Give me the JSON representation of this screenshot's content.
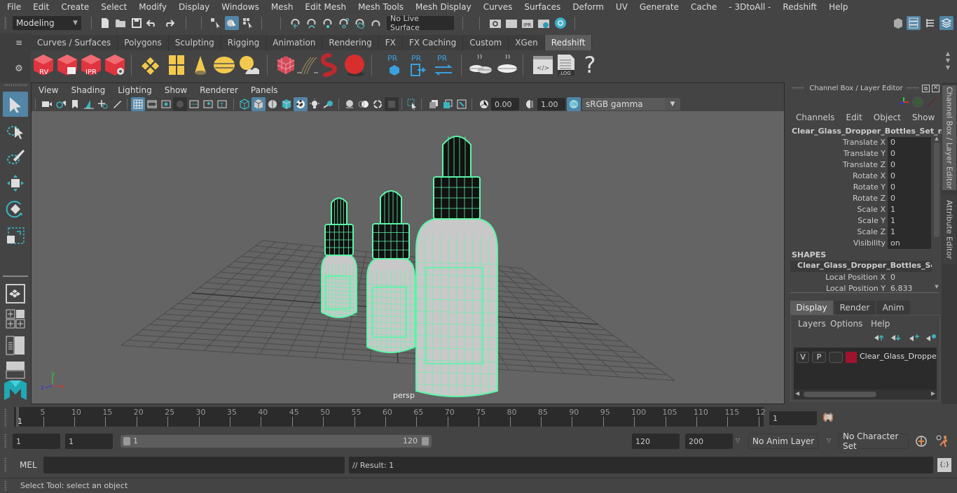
{
  "menubar": {
    "items": [
      "File",
      "Edit",
      "Create",
      "Select",
      "Modify",
      "Display",
      "Windows",
      "Mesh",
      "Edit Mesh",
      "Mesh Tools",
      "Mesh Display",
      "Curves",
      "Surfaces",
      "Deform",
      "UV",
      "Generate",
      "Cache",
      "- 3DtoAll -",
      "Redshift",
      "Help"
    ]
  },
  "statusline": {
    "workspace_mode": "Modeling",
    "live_surface": "No Live Surface",
    "icons": [
      "new-scene-icon",
      "open-scene-icon",
      "save-scene-icon",
      "undo-icon",
      "redo-icon",
      "select-hierarchy-icon",
      "select-object-icon",
      "select-component-icon",
      "snap-grid-icon",
      "snap-curve-icon",
      "snap-point-icon",
      "snap-view-plane-icon",
      "snap-surface-icon",
      "make-live-icon",
      "render-view-icon",
      "render-current-icon",
      "ipr-render-icon",
      "render-settings-icon",
      "hypershade-icon"
    ]
  },
  "shelf": {
    "tabs": [
      {
        "label": "Curves / Surfaces",
        "active": false
      },
      {
        "label": "Polygons",
        "active": false
      },
      {
        "label": "Sculpting",
        "active": false
      },
      {
        "label": "Rigging",
        "active": false
      },
      {
        "label": "Animation",
        "active": false
      },
      {
        "label": "Rendering",
        "active": false
      },
      {
        "label": "FX",
        "active": false
      },
      {
        "label": "FX Caching",
        "active": false
      },
      {
        "label": "Custom",
        "active": false
      },
      {
        "label": "XGen",
        "active": false
      },
      {
        "label": "Redshift",
        "active": true
      }
    ],
    "buttons": [
      {
        "name": "rs-render-view",
        "label": "RV"
      },
      {
        "name": "rs-batch-render",
        "label": ""
      },
      {
        "name": "rs-ipr",
        "label": "IPR"
      },
      {
        "name": "rs-render-settings",
        "label": ""
      },
      {
        "name": "rs-area-light",
        "label": ""
      },
      {
        "name": "rs-portal-light",
        "label": ""
      },
      {
        "name": "rs-ies-light",
        "label": ""
      },
      {
        "name": "rs-dome-light",
        "label": ""
      },
      {
        "name": "rs-sun-sky",
        "label": ""
      },
      {
        "name": "rs-proxy",
        "label": ""
      },
      {
        "name": "rs-hair",
        "label": ""
      },
      {
        "name": "rs-volume",
        "label": ""
      },
      {
        "name": "rs-sphere",
        "label": ""
      },
      {
        "name": "pr-create",
        "label": "PR"
      },
      {
        "name": "pr-export",
        "label": "PR"
      },
      {
        "name": "pr-convert",
        "label": "PR"
      },
      {
        "name": "rs-bake-set",
        "label": ""
      },
      {
        "name": "rs-bake",
        "label": ""
      },
      {
        "name": "rs-script",
        "label": "</>"
      },
      {
        "name": "rs-log",
        "label": ".LOG"
      },
      {
        "name": "rs-help",
        "label": "?"
      }
    ]
  },
  "viewport": {
    "menu": [
      "View",
      "Shading",
      "Lighting",
      "Show",
      "Renderer",
      "Panels"
    ],
    "exposure": "0.00",
    "gamma": "1.00",
    "color_management": "ON",
    "color_space": "sRGB gamma",
    "camera_label": "persp",
    "axis": {
      "x": "x",
      "y": "y",
      "z": "z"
    },
    "wire_color": "#5cf5a8"
  },
  "channelbox": {
    "title": "Channel Box / Layer Editor",
    "menu": [
      "Channels",
      "Edit",
      "Object",
      "Show"
    ],
    "object_name": "Clear_Glass_Dropper_Bottles_Set_nc...",
    "channels": [
      {
        "label": "Translate X",
        "value": "0"
      },
      {
        "label": "Translate Y",
        "value": "0"
      },
      {
        "label": "Translate Z",
        "value": "0"
      },
      {
        "label": "Rotate X",
        "value": "0"
      },
      {
        "label": "Rotate Y",
        "value": "0"
      },
      {
        "label": "Rotate Z",
        "value": "0"
      },
      {
        "label": "Scale X",
        "value": "1"
      },
      {
        "label": "Scale Y",
        "value": "1"
      },
      {
        "label": "Scale Z",
        "value": "1"
      },
      {
        "label": "Visibility",
        "value": "on"
      }
    ],
    "shapes_header": "SHAPES",
    "shape_name": "Clear_Glass_Dropper_Bottles_Set_...",
    "shape_channels": [
      {
        "label": "Local Position X",
        "value": "0"
      },
      {
        "label": "Local Position Y",
        "value": "6.833"
      }
    ]
  },
  "layer_editor": {
    "tabs": [
      {
        "label": "Display",
        "active": true
      },
      {
        "label": "Render",
        "active": false
      },
      {
        "label": "Anim",
        "active": false
      }
    ],
    "menu": [
      "Layers",
      "Options",
      "Help"
    ],
    "layers": [
      {
        "v": "V",
        "p": "P",
        "color": "#a0132e",
        "name": "Clear_Glass_Dropper_E"
      }
    ]
  },
  "side_tabs": [
    "Channel Box / Layer Editor",
    "Attribute Editor"
  ],
  "timeslider": {
    "ticks": [
      5,
      10,
      15,
      20,
      25,
      30,
      35,
      40,
      45,
      50,
      55,
      60,
      65,
      70,
      75,
      80,
      85,
      90,
      95,
      100,
      105,
      110,
      115,
      "12"
    ],
    "current_frame_marker": "1",
    "current_frame": "1"
  },
  "range": {
    "start": "1",
    "playback_start": "1",
    "slider_min": "1",
    "slider_max": "120",
    "playback_end": "120",
    "end": "200",
    "anim_layer": "No Anim Layer",
    "character_set": "No Character Set"
  },
  "cmdline": {
    "language": "MEL",
    "input": "",
    "result": "// Result: 1"
  },
  "helpline": {
    "text": "Select Tool: select an object"
  }
}
